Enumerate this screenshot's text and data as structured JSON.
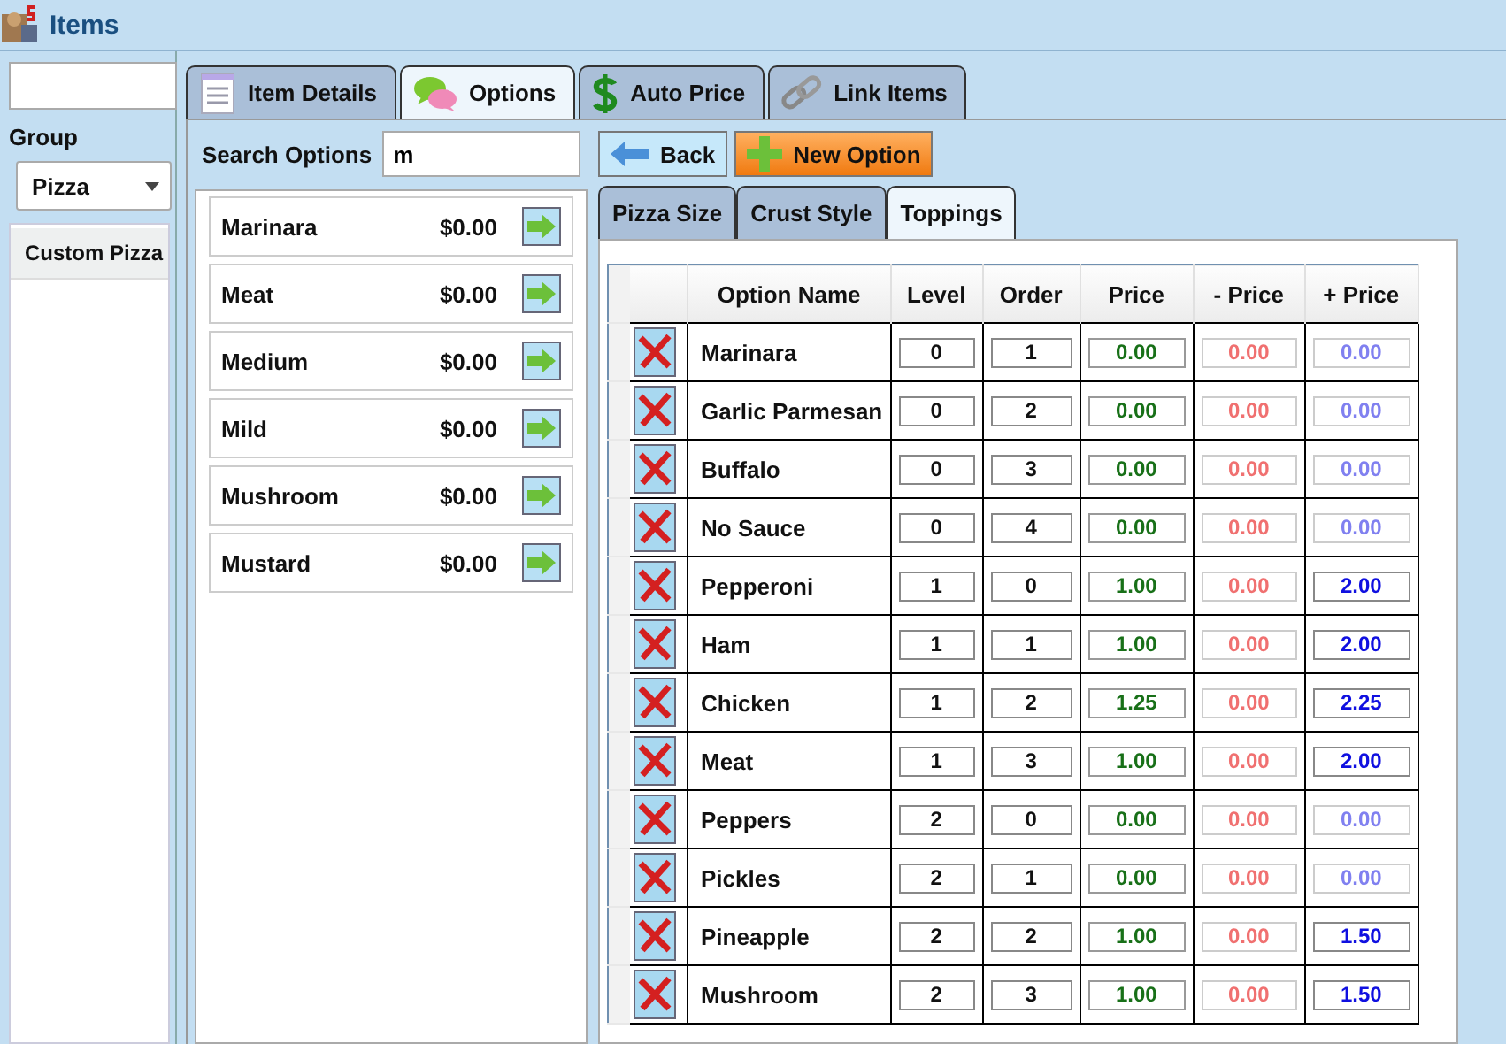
{
  "window": {
    "title": "Items"
  },
  "sidebar": {
    "group_label": "Group",
    "group_value": "Pizza",
    "items": [
      {
        "label": "Custom Pizza",
        "selected": true
      }
    ]
  },
  "tabs": [
    {
      "label": "Item Details",
      "kind": "document",
      "selected": false
    },
    {
      "label": "Options",
      "kind": "chat",
      "selected": true
    },
    {
      "label": "Auto Price",
      "kind": "dollar",
      "selected": false
    },
    {
      "label": "Link Items",
      "kind": "chain",
      "selected": false
    }
  ],
  "search": {
    "label": "Search Options",
    "value": "m"
  },
  "results": [
    {
      "name": "Marinara",
      "price": "$0.00"
    },
    {
      "name": "Meat",
      "price": "$0.00"
    },
    {
      "name": "Medium",
      "price": "$0.00"
    },
    {
      "name": "Mild",
      "price": "$0.00"
    },
    {
      "name": "Mushroom",
      "price": "$0.00"
    },
    {
      "name": "Mustard",
      "price": "$0.00"
    }
  ],
  "buttons": {
    "back": "Back",
    "new_option": "New Option"
  },
  "subtabs": [
    {
      "label": "Pizza Size",
      "selected": false
    },
    {
      "label": "Crust Style",
      "selected": false
    },
    {
      "label": "Toppings",
      "selected": true
    }
  ],
  "table": {
    "columns": [
      "Option Name",
      "Level",
      "Order",
      "Price",
      "- Price",
      "+ Price"
    ],
    "rows": [
      {
        "name": "Marinara",
        "level": "0",
        "order": "1",
        "price": "0.00",
        "minus": "0.00",
        "plus": "0.00",
        "plus_set": false
      },
      {
        "name": "Garlic Parmesan",
        "level": "0",
        "order": "2",
        "price": "0.00",
        "minus": "0.00",
        "plus": "0.00",
        "plus_set": false
      },
      {
        "name": "Buffalo",
        "level": "0",
        "order": "3",
        "price": "0.00",
        "minus": "0.00",
        "plus": "0.00",
        "plus_set": false
      },
      {
        "name": "No Sauce",
        "level": "0",
        "order": "4",
        "price": "0.00",
        "minus": "0.00",
        "plus": "0.00",
        "plus_set": false
      },
      {
        "name": "Pepperoni",
        "level": "1",
        "order": "0",
        "price": "1.00",
        "minus": "0.00",
        "plus": "2.00",
        "plus_set": true
      },
      {
        "name": "Ham",
        "level": "1",
        "order": "1",
        "price": "1.00",
        "minus": "0.00",
        "plus": "2.00",
        "plus_set": true
      },
      {
        "name": "Chicken",
        "level": "1",
        "order": "2",
        "price": "1.25",
        "minus": "0.00",
        "plus": "2.25",
        "plus_set": true
      },
      {
        "name": "Meat",
        "level": "1",
        "order": "3",
        "price": "1.00",
        "minus": "0.00",
        "plus": "2.00",
        "plus_set": true
      },
      {
        "name": "Peppers",
        "level": "2",
        "order": "0",
        "price": "0.00",
        "minus": "0.00",
        "plus": "0.00",
        "plus_set": false
      },
      {
        "name": "Pickles",
        "level": "2",
        "order": "1",
        "price": "0.00",
        "minus": "0.00",
        "plus": "0.00",
        "plus_set": false
      },
      {
        "name": "Pineapple",
        "level": "2",
        "order": "2",
        "price": "1.00",
        "minus": "0.00",
        "plus": "1.50",
        "plus_set": true
      },
      {
        "name": "Mushroom",
        "level": "2",
        "order": "3",
        "price": "1.00",
        "minus": "0.00",
        "plus": "1.50",
        "plus_set": true
      }
    ]
  }
}
